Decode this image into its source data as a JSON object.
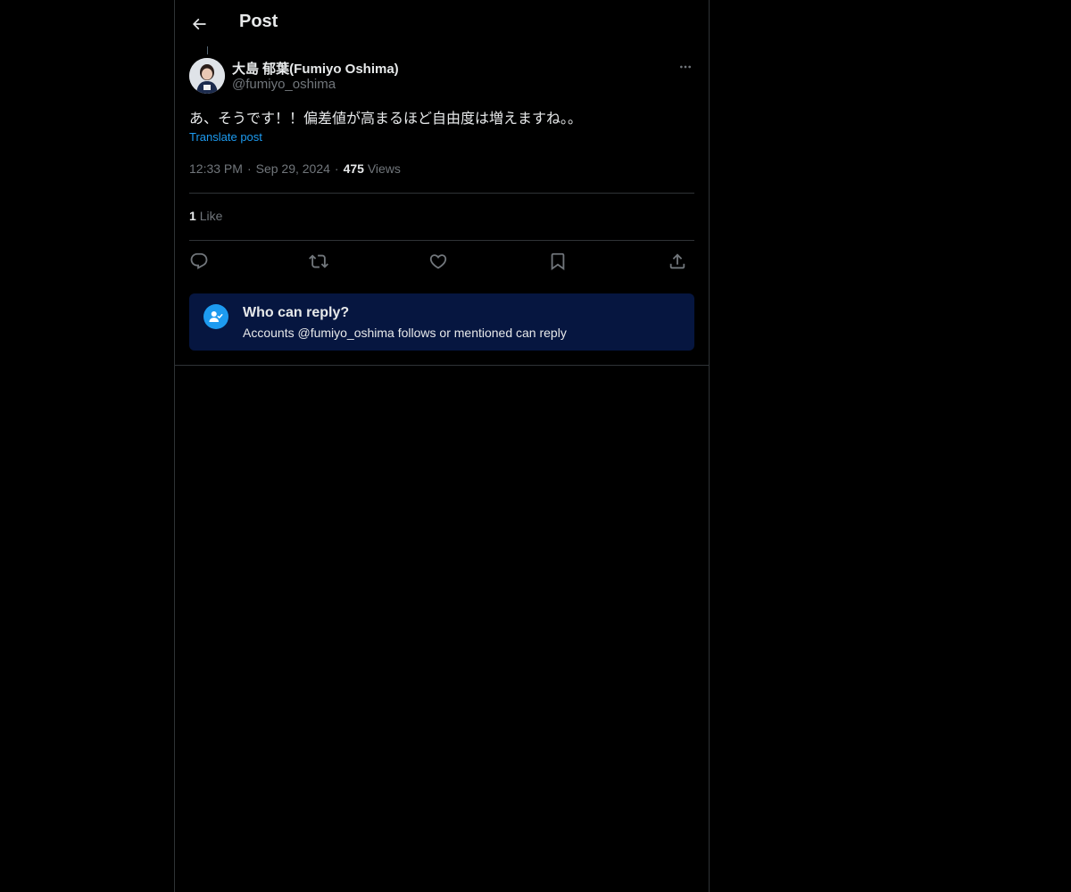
{
  "header": {
    "title": "Post"
  },
  "post": {
    "display_name": "大島 郁葉(Fumiyo Oshima)",
    "handle": "@fumiyo_oshima",
    "text": "あ、そうです！！偏差値が高まるほど自由度は増えますね。。",
    "translate_label": "Translate post",
    "time": "12:33 PM",
    "date": "Sep 29, 2024",
    "views_count": "475",
    "views_label": "Views",
    "likes_count": "1",
    "likes_label": "Like"
  },
  "actions": [
    "reply-icon",
    "repost-icon",
    "like-icon",
    "bookmark-icon",
    "share-icon"
  ],
  "reply_restriction": {
    "title": "Who can reply?",
    "subtitle": "Accounts @fumiyo_oshima follows or mentioned can reply"
  },
  "colors": {
    "background": "#000000",
    "text_primary": "#e7e9ea",
    "text_secondary": "#71767b",
    "accent": "#1d9bf0",
    "border": "#2f3336",
    "reply_box": "#061640"
  }
}
